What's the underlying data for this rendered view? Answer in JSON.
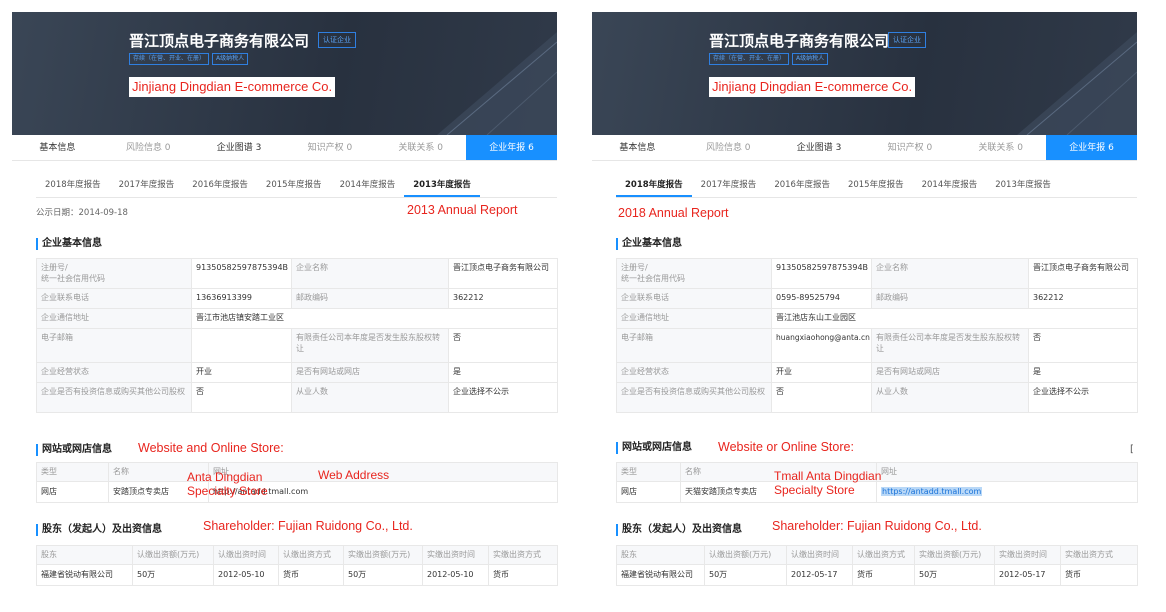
{
  "company": {
    "name": "晋江顶点电子商务有限公司",
    "badge": "认证企业",
    "tags": [
      "存续（在营、开业、在册）",
      "A级纳税人"
    ],
    "english_annotation": "Jinjiang Dingdian E-commerce Co."
  },
  "nav": {
    "tabs": [
      "基本信息",
      "风险信息 0",
      "企业图谱 3",
      "知识产权 0",
      "关联关系 0",
      "企业年报 6"
    ]
  },
  "year_tabs": [
    "2018年度报告",
    "2017年度报告",
    "2016年度报告",
    "2015年度报告",
    "2014年度报告",
    "2013年度报告"
  ],
  "basic_title": "企业基本信息",
  "basic_labels": {
    "reg_no": "注册号/\n统一社会信用代码",
    "name": "企业名称",
    "phone": "企业联系电话",
    "postal": "邮政编码",
    "address": "企业通信地址",
    "email": "电子邮箱",
    "transfer": "有限责任公司本年度是否发生股东股权转让",
    "status": "企业经营状态",
    "has_site": "是否有网站或网店",
    "invest": "企业是否有投资信息或购买其他公司股权",
    "employees": "从业人数"
  },
  "website_labels": {
    "type": "类型",
    "name": "名称",
    "address": "网址"
  },
  "shareholder_title": "股东（发起人）及出资信息",
  "shareholder_annotation": "Shareholder:  Fujian Ruidong Co., Ltd.",
  "shareholder_headers": [
    "股东",
    "认缴出资额(万元)",
    "认缴出资时间",
    "认缴出资方式",
    "实缴出资额(万元)",
    "实缴出资时间",
    "实缴出资方式"
  ],
  "left": {
    "date_label": "公示日期：2014-09-18",
    "report_annotation": "2013 Annual Report",
    "basic": {
      "reg_no": "91350582597875394B",
      "name": "晋江顶点电子商务有限公司",
      "phone": "13636913399",
      "postal": "362212",
      "address": "晋江市池店镇安踏工业区",
      "email": "",
      "transfer": "否",
      "status": "开业",
      "has_site": "是",
      "invest": "否",
      "employees": "企业选择不公示"
    },
    "website_title": "网站或网店信息",
    "website_annotation": "Website and Online Store:",
    "website_row": {
      "type": "网店",
      "name": "安踏顶点专卖店",
      "address": "http://antadd.tmall.com"
    },
    "name_annotation": "Anta Dingdian\nSpecialty Store",
    "address_annotation": "Web Address",
    "shareholder_row": [
      "福建省锐动有限公司",
      "50万",
      "2012-05-10",
      "货币",
      "50万",
      "2012-05-10",
      "货币"
    ]
  },
  "right": {
    "report_annotation": "2018 Annual Report",
    "basic": {
      "reg_no": "91350582597875394B",
      "name": "晋江顶点电子商务有限公司",
      "phone": "0595-89525794",
      "postal": "362212",
      "address": "晋江池店东山工业园区",
      "email": "huangxiaohong@anta.cn",
      "transfer": "否",
      "status": "开业",
      "has_site": "是",
      "invest": "否",
      "employees": "企业选择不公示"
    },
    "website_title": "网站或网店信息",
    "website_annotation": "Website or Online Store:",
    "website_row": {
      "type": "网店",
      "name": "天猫安踏顶点专卖店",
      "address": "https://antadd.tmall.com"
    },
    "name_annotation": "Tmall Anta Dingdian\nSpecialty Store",
    "scroll_mark": "[",
    "shareholder_row": [
      "福建省锐动有限公司",
      "50万",
      "2012-05-17",
      "货币",
      "50万",
      "2012-05-17",
      "货币"
    ]
  }
}
